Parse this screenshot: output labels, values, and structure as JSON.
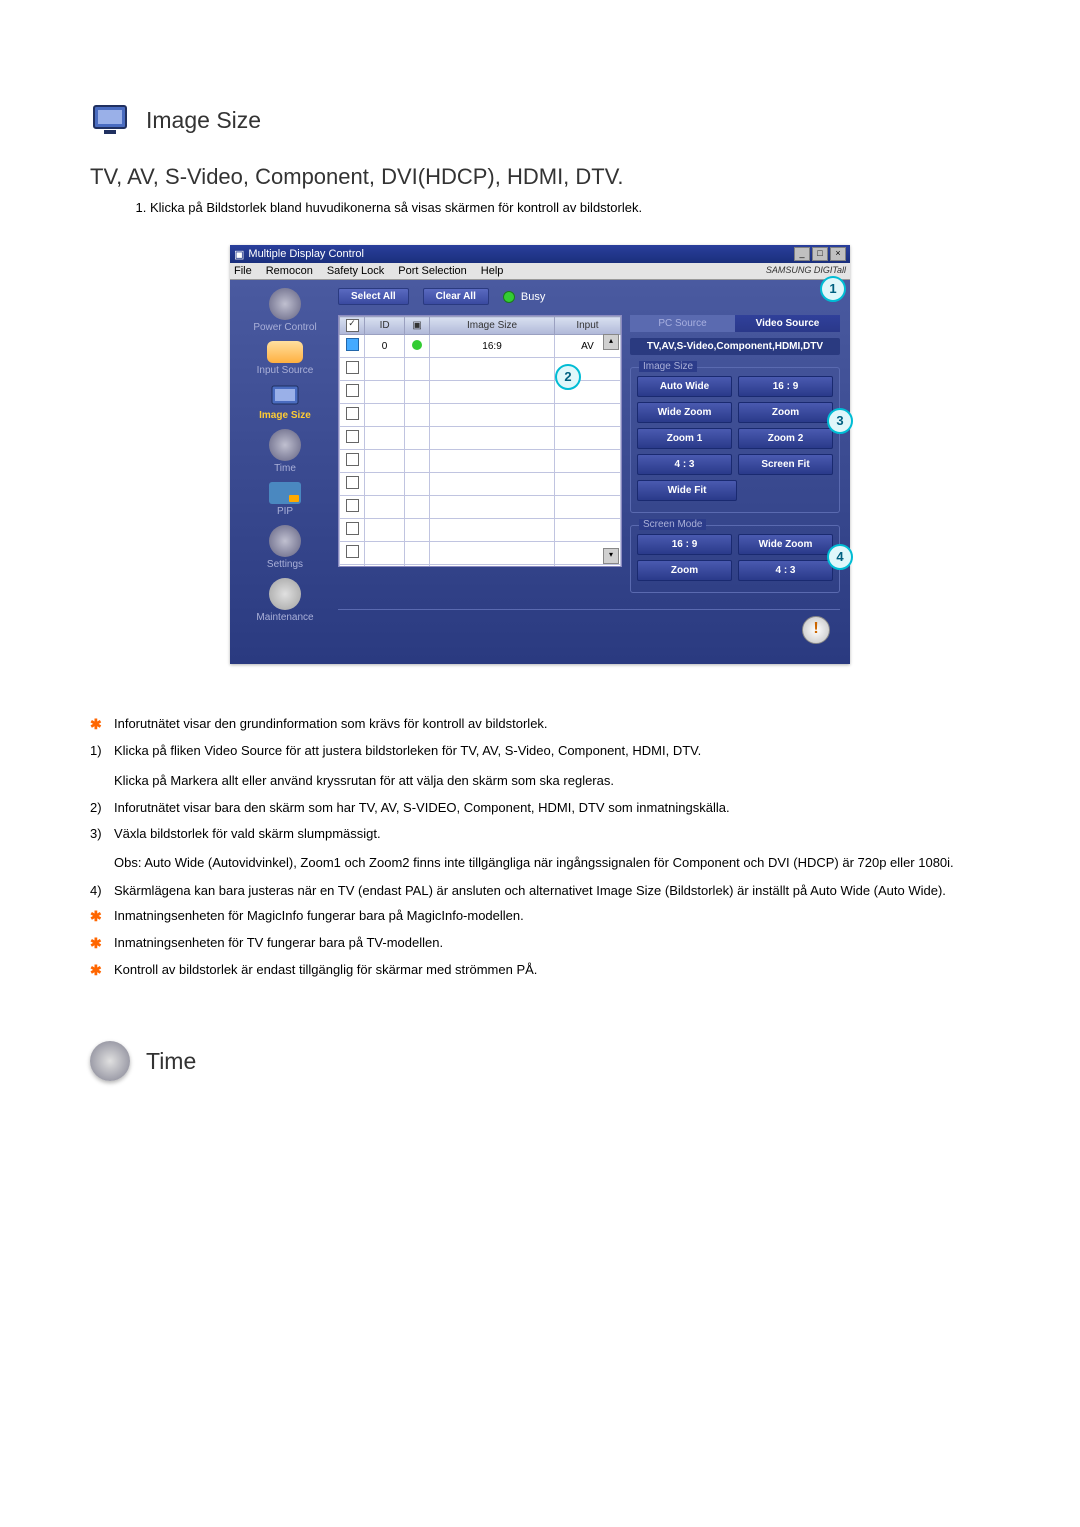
{
  "section1": {
    "title": "Image Size",
    "subtitle": "TV, AV, S-Video, Component, DVI(HDCP), HDMI, DTV.",
    "intro_item": "Klicka på Bildstorlek bland huvudikonerna så visas skärmen för kontroll av bildstorlek."
  },
  "screenshot": {
    "window_title": "Multiple Display Control",
    "menu": {
      "file": "File",
      "remocon": "Remocon",
      "safety_lock": "Safety Lock",
      "port_selection": "Port Selection",
      "help": "Help",
      "brand": "SAMSUNG DIGITall"
    },
    "sidebar": {
      "power_control": "Power Control",
      "input_source": "Input Source",
      "image_size": "Image Size",
      "time": "Time",
      "pip": "PIP",
      "settings": "Settings",
      "maintenance": "Maintenance"
    },
    "buttons": {
      "select_all": "Select All",
      "clear_all": "Clear All",
      "busy": "Busy"
    },
    "table": {
      "col_id": "ID",
      "col_image_size": "Image Size",
      "col_input": "Input",
      "row0": {
        "id": "0",
        "image_size": "16:9",
        "input": "AV"
      }
    },
    "right": {
      "tab_pc": "PC Source",
      "tab_video": "Video Source",
      "video_label": "TV,AV,S-Video,Component,HDMI,DTV",
      "group_image_size": "Image Size",
      "group_screen_mode": "Screen Mode",
      "image_size_opts": {
        "auto_wide": "Auto Wide",
        "sixteen_nine": "16 : 9",
        "wide_zoom": "Wide Zoom",
        "zoom": "Zoom",
        "zoom1": "Zoom 1",
        "zoom2": "Zoom 2",
        "four_three": "4 : 3",
        "screen_fit": "Screen Fit",
        "wide_fit": "Wide Fit"
      },
      "screen_mode_opts": {
        "sixteen_nine": "16 : 9",
        "wide_zoom": "Wide Zoom",
        "zoom": "Zoom",
        "four_three": "4 : 3"
      }
    },
    "callouts": {
      "c1": "1",
      "c2": "2",
      "c3": "3",
      "c4": "4"
    }
  },
  "notes": {
    "n_star1": "Inforutnätet visar den grundinformation som krävs för kontroll av bildstorlek.",
    "n1_a": "Klicka på fliken Video Source för att justera bildstorleken för TV, AV, S-Video, Component, HDMI, DTV.",
    "n1_b": "Klicka på Markera allt eller använd kryssrutan för att välja den skärm som ska regleras.",
    "n2": "Inforutnätet visar bara den skärm som har TV, AV, S-VIDEO, Component, HDMI, DTV som inmatningskälla.",
    "n3_a": "Växla bildstorlek för vald skärm slumpmässigt.",
    "n3_b": "Obs: Auto Wide (Autovidvinkel), Zoom1 och Zoom2 finns inte tillgängliga när ingångssignalen för Component och DVI (HDCP) är 720p eller 1080i.",
    "n4": "Skärmlägena kan bara justeras när en TV (endast PAL) är ansluten och alternativet Image Size (Bildstorlek) är inställt på Auto Wide (Auto Wide).",
    "n_star2": "Inmatningsenheten för MagicInfo fungerar bara på MagicInfo-modellen.",
    "n_star3": "Inmatningsenheten för TV fungerar bara på TV-modellen.",
    "n_star4": "Kontroll av bildstorlek är endast tillgänglig för skärmar med strömmen PÅ."
  },
  "section2": {
    "title": "Time"
  }
}
